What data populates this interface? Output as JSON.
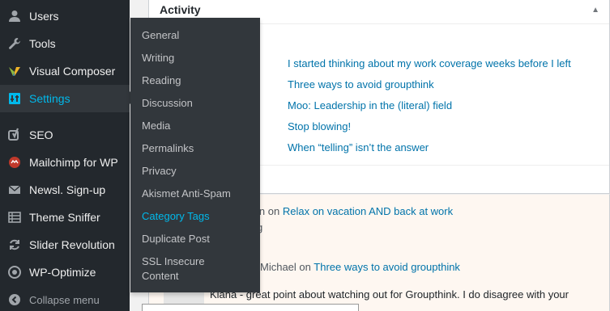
{
  "sidebar": {
    "items": [
      {
        "label": "Users",
        "icon": "users-icon"
      },
      {
        "label": "Tools",
        "icon": "wrench-icon"
      },
      {
        "label": "Visual Composer",
        "icon": "visual-composer-icon"
      },
      {
        "label": "Settings",
        "icon": "settings-icon",
        "current": true
      },
      {
        "label": "SEO",
        "icon": "yoast-icon"
      },
      {
        "label": "Mailchimp for WP",
        "icon": "mailchimp-icon"
      },
      {
        "label": "Newsl. Sign-up",
        "icon": "envelope-icon"
      },
      {
        "label": "Theme Sniffer",
        "icon": "list-icon"
      },
      {
        "label": "Slider Revolution",
        "icon": "refresh-icon"
      },
      {
        "label": "WP-Optimize",
        "icon": "wp-optimize-icon"
      },
      {
        "label": "Collapse menu",
        "icon": "collapse-icon"
      }
    ]
  },
  "settings_flyout": {
    "items": [
      "General",
      "Writing",
      "Reading",
      "Discussion",
      "Media",
      "Permalinks",
      "Privacy",
      "Akismet Anti-Spam",
      "Category Tags",
      "Duplicate Post",
      "SSL Insecure Content"
    ],
    "current_index": 8
  },
  "activity": {
    "title": "Activity",
    "toggle_glyph": "▲",
    "recent_posts": [
      "I started thinking about my work coverage weeks before I left",
      "Three ways to avoid groupthink",
      "Moo: Leadership in the (literal) field",
      "Stop blowing!",
      "When “telling” isn’t the answer"
    ]
  },
  "comments": [
    {
      "author_fragment": "in",
      "on": "on",
      "post": "Relax on vacation AND back at work",
      "extra_fragment": "g"
    },
    {
      "author_fragment": "Michael",
      "on": "on",
      "post": "Three ways to avoid groupthink",
      "text": "Kiana - great point about watching out for Groupthink. I do disagree with your"
    }
  ],
  "colors": {
    "sidebar_bg": "#23282d",
    "submenu_bg": "#32373c",
    "accent": "#00b9eb",
    "link": "#0073aa"
  }
}
